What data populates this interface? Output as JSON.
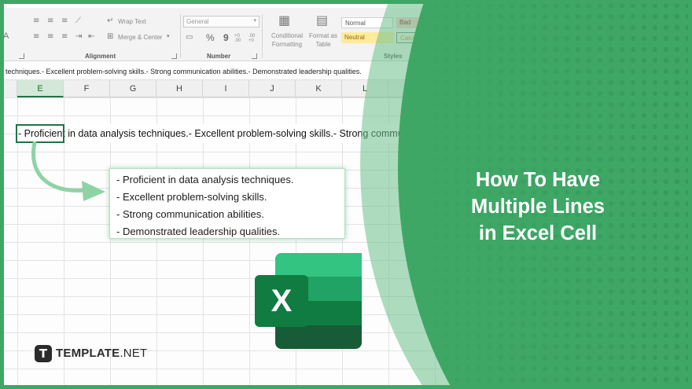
{
  "ribbon": {
    "wrap_text": "Wrap Text",
    "merge_center": "Merge & Center",
    "number_format": "General",
    "conditional_formatting": "Conditional Formatting",
    "format_as_table": "Format as Table",
    "style_normal": "Normal",
    "style_neutral": "Neutral",
    "style_bad": "Bad",
    "style_calc": "Calcu",
    "group_alignment": "Alignment",
    "group_number": "Number",
    "group_styles": "Styles",
    "percent_symbol": "%",
    "comma_symbol": "9",
    "inc_decimal": "+0 .00",
    "dec_decimal": ".00 +0",
    "font_a_glyph": "A"
  },
  "formula_bar": {
    "text": "s techniques.- Excellent problem-solving skills.- Strong communication abilities.- Demonstrated leadership qualities."
  },
  "columns": [
    "E",
    "F",
    "G",
    "H",
    "I",
    "J",
    "K",
    "L"
  ],
  "active_column": "E",
  "cell": {
    "content": "- Proficient in data analysis techniques.- Excellent problem-solving skills.- Strong communication abilities."
  },
  "callout": {
    "lines": [
      "- Proficient in data analysis techniques.",
      "- Excellent problem-solving skills.",
      "- Strong communication abilities.",
      "- Demonstrated leadership qualities."
    ]
  },
  "title": "How To Have\nMultiple Lines\nin Excel Cell",
  "excel_logo": {
    "letter": "X"
  },
  "brand": {
    "mark": "T",
    "name_bold": "TEMPLATE",
    "name_rest": ".NET"
  },
  "colors": {
    "excel_green": "#217346",
    "panel_green": "#3ea765",
    "panel_dark": "#2f8e53",
    "accent_light": "#8fd3a5"
  }
}
